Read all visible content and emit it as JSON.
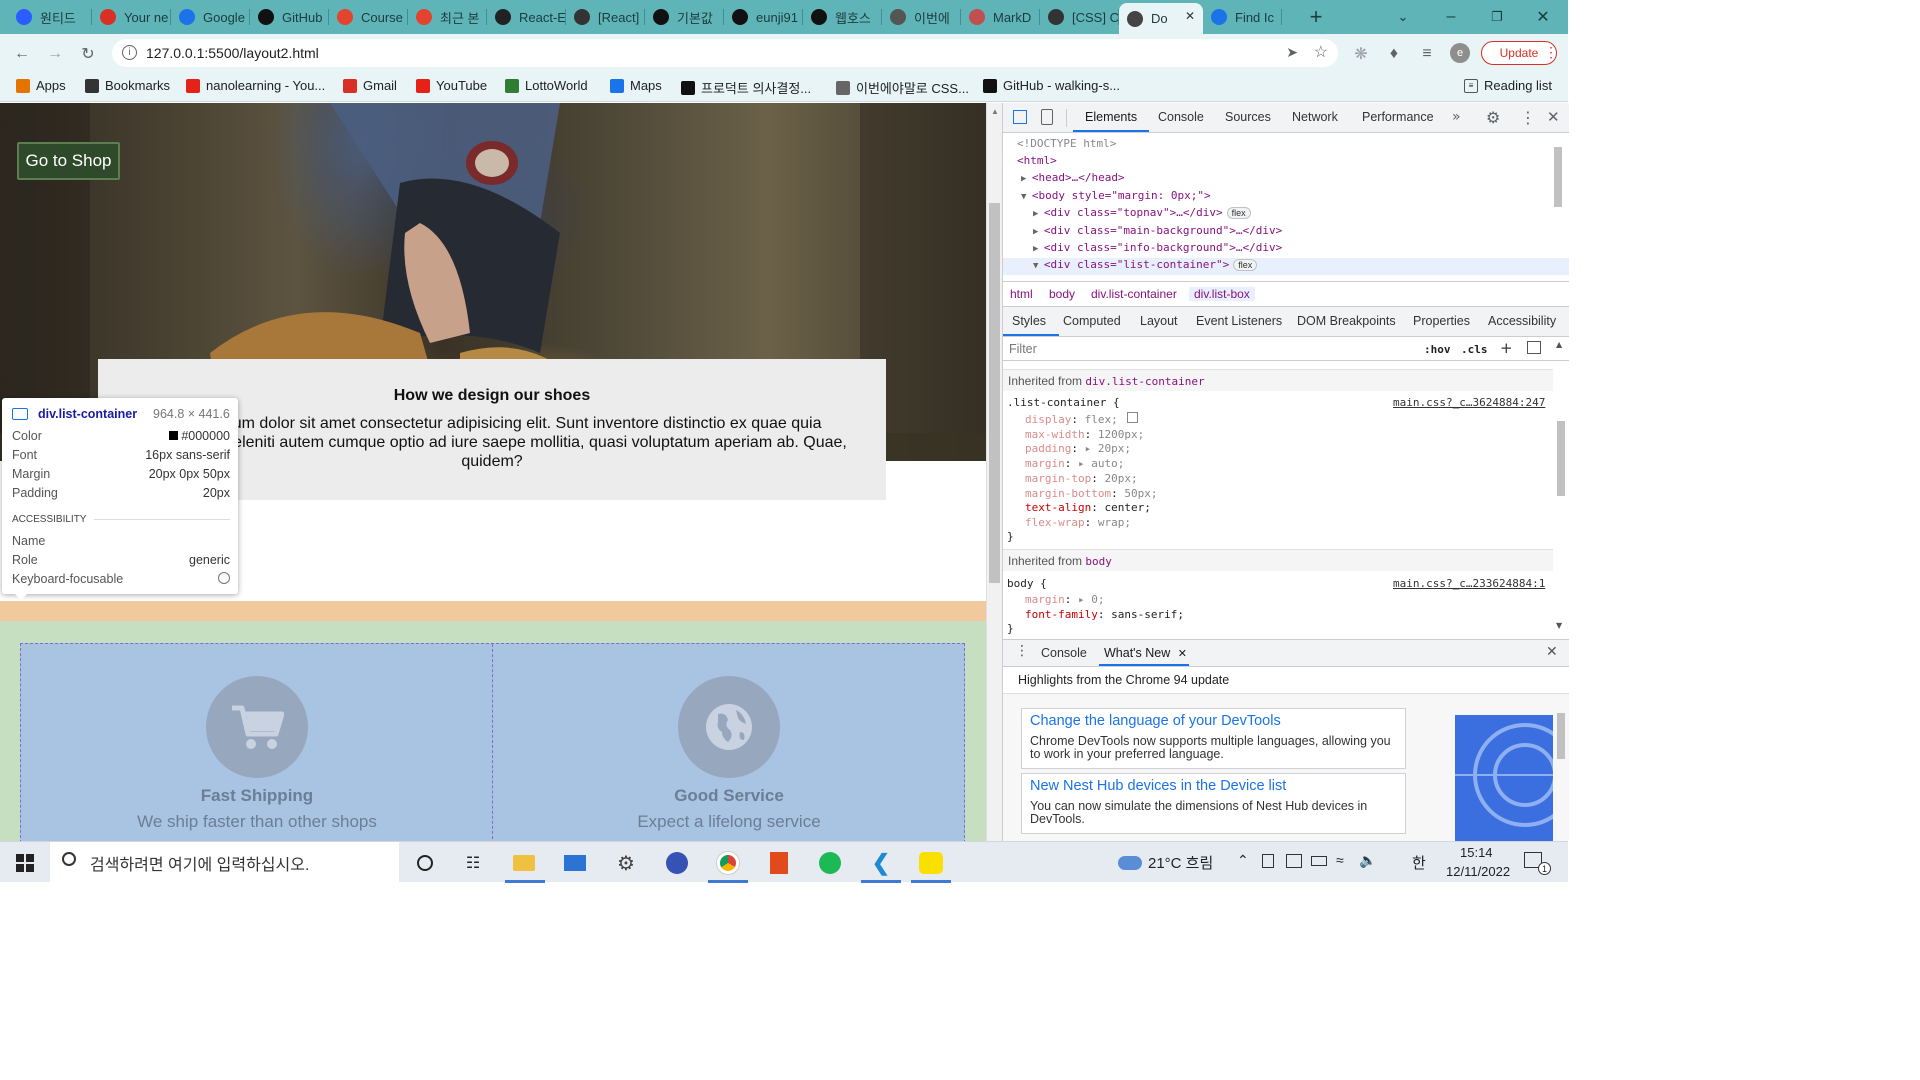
{
  "browser": {
    "tabs": [
      {
        "label": "원티드",
        "icon": "wanted-icon",
        "color": "#2b5cff"
      },
      {
        "label": "Your ne",
        "icon": "gmail-icon",
        "color": "#d93025"
      },
      {
        "label": "Google",
        "icon": "google-calendar-icon",
        "color": "#1a73e8"
      },
      {
        "label": "GitHub",
        "icon": "github-icon",
        "color": "#111111"
      },
      {
        "label": "Course",
        "icon": "tomato-icon",
        "color": "#e2442f"
      },
      {
        "label": "최근 본",
        "icon": "tomato-icon",
        "color": "#e2442f"
      },
      {
        "label": "React-E",
        "icon": "react-icon",
        "color": "#222222"
      },
      {
        "label": "[React]",
        "icon": "dots-icon",
        "color": "#333333"
      },
      {
        "label": "기본값",
        "icon": "m-icon",
        "color": "#111111"
      },
      {
        "label": "eunji91",
        "icon": "github-icon",
        "color": "#111111"
      },
      {
        "label": "웹호스",
        "icon": "circle-icon",
        "color": "#111111"
      },
      {
        "label": "이번에",
        "icon": "ghost-icon",
        "color": "#555555"
      },
      {
        "label": "MarkD",
        "icon": "avatar-icon",
        "color": "#c0504d"
      },
      {
        "label": "[CSS] C",
        "icon": "dots-icon",
        "color": "#333333"
      },
      {
        "label": "Do",
        "icon": "globe-icon",
        "color": "#444444",
        "active": true
      },
      {
        "label": "Find Ic",
        "icon": "flag-icon",
        "color": "#1a73e8"
      }
    ],
    "url": "127.0.0.1:5500/layout2.html",
    "update_label": "Update",
    "avatar_letter": "e",
    "bookmarks": [
      {
        "label": "Apps",
        "icon": "apps-icon"
      },
      {
        "label": "Bookmarks",
        "icon": "star-icon"
      },
      {
        "label": "nanolearning - You...",
        "icon": "youtube-icon"
      },
      {
        "label": "Gmail",
        "icon": "gmail-icon"
      },
      {
        "label": "YouTube",
        "icon": "youtube-icon"
      },
      {
        "label": "LottoWorld",
        "icon": "lotto-icon"
      },
      {
        "label": "Maps",
        "icon": "maps-icon"
      },
      {
        "label": "프로덕트 의사결정...",
        "icon": "notion-icon"
      },
      {
        "label": "이번에야말로 CSS...",
        "icon": "ghost-icon"
      },
      {
        "label": "GitHub - walking-s...",
        "icon": "github-icon"
      }
    ],
    "reading_list": "Reading list"
  },
  "page": {
    "shop_button": "Go to Shop",
    "info_title": "How we design our shoes",
    "info_text": "Lorem ipsum dolor sit amet consectetur adipisicing elit. Sunt inventore distinctio ex quae quia repellendus deleniti autem cumque optio ad iure saepe mollitia, quasi voluptatum aperiam ab. Quae, quidem?",
    "list": [
      {
        "title": "Fast Shipping",
        "subtitle": "We ship faster than other shops",
        "icon": "cart-icon"
      },
      {
        "title": "Good Service",
        "subtitle": "Expect a lifelong service",
        "icon": "globe-icon"
      }
    ],
    "colors": {
      "list_bg": "#a9c3e3",
      "band": "#f2c99c",
      "section": "#c6dfc0"
    }
  },
  "tooltip": {
    "selector": "div.list-container",
    "size": "964.8 × 441.6",
    "rows": [
      {
        "label": "Color",
        "value": "#000000"
      },
      {
        "label": "Font",
        "value": "16px sans-serif"
      },
      {
        "label": "Margin",
        "value": "20px 0px 50px"
      },
      {
        "label": "Padding",
        "value": "20px"
      }
    ],
    "accessibility_header": "ACCESSIBILITY",
    "a11y": [
      {
        "label": "Name",
        "value": ""
      },
      {
        "label": "Role",
        "value": "generic"
      },
      {
        "label": "Keyboard-focusable",
        "value": ""
      }
    ]
  },
  "devtools": {
    "tabs": [
      "Elements",
      "Console",
      "Sources",
      "Network",
      "Performance"
    ],
    "dom": [
      {
        "html": "<!DOCTYPE html>"
      },
      {
        "html": "<html>"
      },
      {
        "html": "<head>…</head>"
      },
      {
        "html": "<body style=\"margin: 0px;\">"
      },
      {
        "html": "<div class=\"topnav\">…</div>",
        "badge": "flex"
      },
      {
        "html": "<div class=\"main-background\">…</div>"
      },
      {
        "html": "<div class=\"info-background\">…</div>"
      },
      {
        "html": "<div class=\"list-container\">",
        "badge": "flex"
      }
    ],
    "breadcrumbs": [
      "html",
      "body",
      "div.list-container",
      "div.list-box"
    ],
    "subtabs": [
      "Styles",
      "Computed",
      "Layout",
      "Event Listeners",
      "DOM Breakpoints",
      "Properties",
      "Accessibility"
    ],
    "filter_placeholder": "Filter",
    "hov": ":hov",
    "cls": ".cls",
    "inherited1_label": "Inherited from",
    "inherited1_src": "div.list-container",
    "rule1_selector": ".list-container {",
    "rule1_file": "main.css?_c…3624884:247",
    "rule1_props": [
      {
        "p": "display",
        "v": "flex;",
        "dim": true
      },
      {
        "p": "max-width",
        "v": "1200px;",
        "dim": true
      },
      {
        "p": "padding",
        "v": "▸ 20px;",
        "dim": true
      },
      {
        "p": "margin",
        "v": "▸ auto;",
        "dim": true
      },
      {
        "p": "margin-top",
        "v": "20px;",
        "dim": true
      },
      {
        "p": "margin-bottom",
        "v": "50px;",
        "dim": true
      },
      {
        "p": "text-align",
        "v": "center;",
        "dim": false
      },
      {
        "p": "flex-wrap",
        "v": "wrap;",
        "dim": true
      }
    ],
    "inherited2_label": "Inherited from",
    "inherited2_src": "body",
    "rule2_selector": "body {",
    "rule2_file": "main.css?_c…233624884:1",
    "rule2_props": [
      {
        "p": "margin",
        "v": "▸ 0;",
        "dim": true
      },
      {
        "p": "font-family",
        "v": "sans-serif;",
        "dim": false
      }
    ],
    "drawer_tabs": [
      "Console",
      "What's New"
    ],
    "highlights": "Highlights from the Chrome 94 update",
    "news": [
      {
        "title": "Change the language of your DevTools",
        "desc": "Chrome DevTools now supports multiple languages, allowing you to work in your preferred language."
      },
      {
        "title": "New Nest Hub devices in the Device list",
        "desc": "You can now simulate the dimensions of Nest Hub devices in DevTools."
      }
    ]
  },
  "taskbar": {
    "search_placeholder": "검색하려면 여기에 입력하십시오.",
    "weather": "21°C 흐림",
    "ime": "한",
    "time": "15:14",
    "date": "12/11/2022",
    "notifications": "1"
  }
}
